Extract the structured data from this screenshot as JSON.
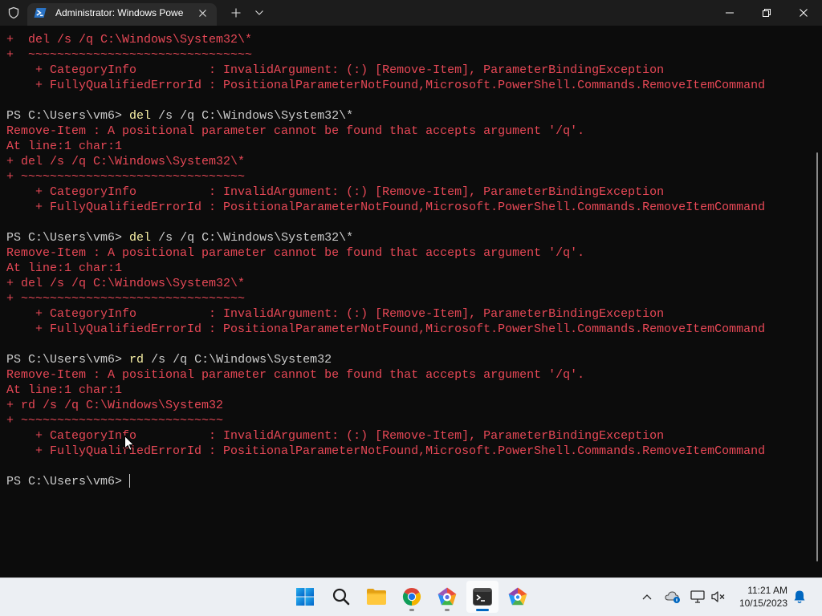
{
  "window": {
    "tab_title": "Administrator: Windows Powe",
    "tab_icon": "powershell-icon",
    "titlebar_icons": [
      "shield-icon",
      "close-icon",
      "plus-icon",
      "chevron-down-icon",
      "minimize-icon",
      "restore-icon",
      "close-icon"
    ]
  },
  "terminal": {
    "colors": {
      "background": "#0c0c0c",
      "foreground": "#cccccc",
      "error": "#e74856",
      "command": "#f9f1a5"
    },
    "scrolled_error": [
      "+  del /s /q C:\\Windows\\System32\\*",
      "+  ~~~~~~~~~~~~~~~~~~~~~~~~~~~~~~~",
      "    + CategoryInfo          : InvalidArgument: (:) [Remove-Item], ParameterBindingException",
      "    + FullyQualifiedErrorId : PositionalParameterNotFound,Microsoft.PowerShell.Commands.RemoveItemCommand"
    ],
    "history": [
      {
        "prompt": "PS C:\\Users\\vm6>",
        "command": "del",
        "args": "/s /q C:\\Windows\\System32\\*",
        "error": [
          "Remove-Item : A positional parameter cannot be found that accepts argument '/q'.",
          "At line:1 char:1",
          "+ del /s /q C:\\Windows\\System32\\*",
          "+ ~~~~~~~~~~~~~~~~~~~~~~~~~~~~~~~",
          "    + CategoryInfo          : InvalidArgument: (:) [Remove-Item], ParameterBindingException",
          "    + FullyQualifiedErrorId : PositionalParameterNotFound,Microsoft.PowerShell.Commands.RemoveItemCommand"
        ]
      },
      {
        "prompt": "PS C:\\Users\\vm6>",
        "command": "del",
        "args": "/s /q C:\\Windows\\System32\\*",
        "error": [
          "Remove-Item : A positional parameter cannot be found that accepts argument '/q'.",
          "At line:1 char:1",
          "+ del /s /q C:\\Windows\\System32\\*",
          "+ ~~~~~~~~~~~~~~~~~~~~~~~~~~~~~~~",
          "    + CategoryInfo          : InvalidArgument: (:) [Remove-Item], ParameterBindingException",
          "    + FullyQualifiedErrorId : PositionalParameterNotFound,Microsoft.PowerShell.Commands.RemoveItemCommand"
        ]
      },
      {
        "prompt": "PS C:\\Users\\vm6>",
        "command": "rd",
        "args": "/s /q C:\\Windows\\System32",
        "error": [
          "Remove-Item : A positional parameter cannot be found that accepts argument '/q'.",
          "At line:1 char:1",
          "+ rd /s /q C:\\Windows\\System32",
          "+ ~~~~~~~~~~~~~~~~~~~~~~~~~~~~",
          "    + CategoryInfo          : InvalidArgument: (:) [Remove-Item], ParameterBindingException",
          "    + FullyQualifiedErrorId : PositionalParameterNotFound,Microsoft.PowerShell.Commands.RemoveItemCommand"
        ]
      }
    ],
    "current_prompt": "PS C:\\Users\\vm6>"
  },
  "taskbar": {
    "colors": {
      "background": "#eceff3",
      "accent": "#0067c0"
    },
    "pinned_apps": [
      {
        "icon": "windows-start-icon"
      },
      {
        "icon": "search-icon"
      },
      {
        "icon": "file-explorer-icon"
      },
      {
        "icon": "chrome-icon",
        "running": true
      },
      {
        "icon": "pentagon-app-icon",
        "running": true
      },
      {
        "icon": "windows-terminal-icon",
        "running": true,
        "active": true
      },
      {
        "icon": "pentagon-app-icon-2"
      }
    ],
    "tray_icons": [
      "chevron-up-icon",
      "cloud-icon",
      "network-icon",
      "volume-muted-icon",
      "notification-bell-icon"
    ],
    "time": "11:21 AM",
    "date": "10/15/2023"
  }
}
